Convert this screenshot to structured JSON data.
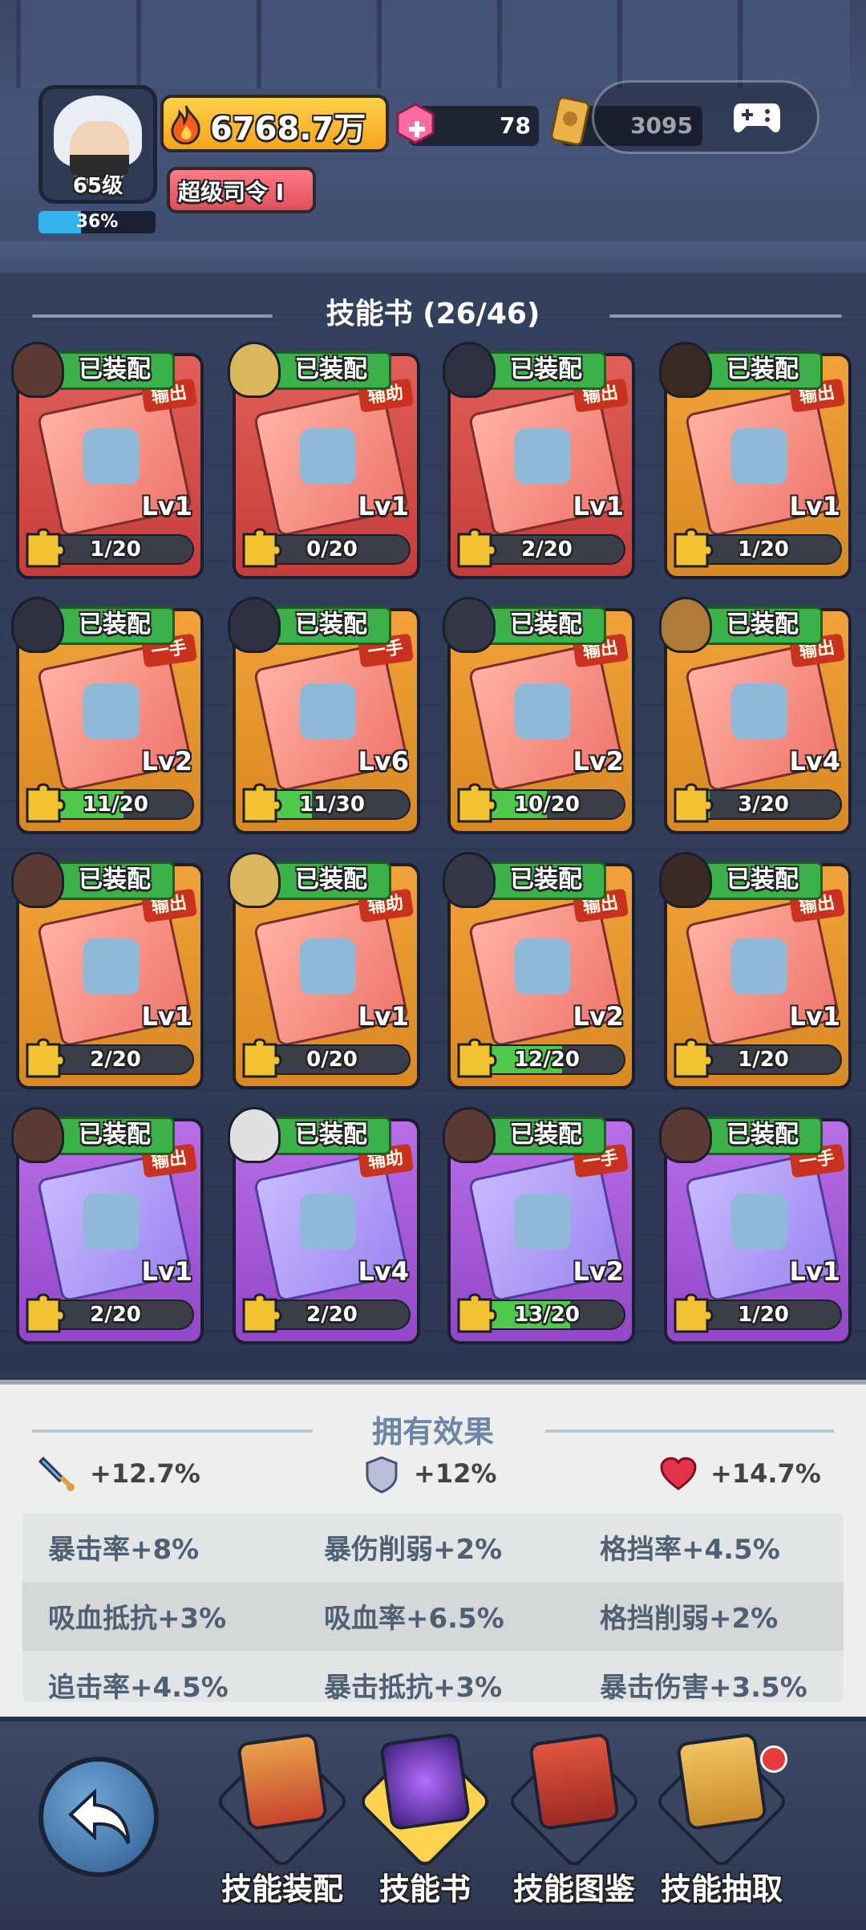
{
  "player": {
    "level": "65级",
    "exp_percent": "36%",
    "exp_fraction": 0.36,
    "power": "6768.7万",
    "title": "超级司令 I",
    "gems": "78",
    "tickets": "3095"
  },
  "section_title": "技能书 (26/46)",
  "cards": [
    {
      "equip": "已装配",
      "tag": "输出",
      "level": "Lv1",
      "progress": "1/20",
      "fill": 0.05,
      "rarity": "red",
      "hero": "#5a3a32"
    },
    {
      "equip": "已装配",
      "tag": "辅助",
      "level": "Lv1",
      "progress": "0/20",
      "fill": 0.0,
      "rarity": "red",
      "hero": "#d9b75a"
    },
    {
      "equip": "已装配",
      "tag": "输出",
      "level": "Lv1",
      "progress": "2/20",
      "fill": 0.1,
      "rarity": "red",
      "hero": "#2f3142"
    },
    {
      "equip": "已装配",
      "tag": "输出",
      "level": "Lv1",
      "progress": "1/20",
      "fill": 0.05,
      "rarity": "orange",
      "hero": "#3a2a22"
    },
    {
      "equip": "已装配",
      "tag": "一手",
      "level": "Lv2",
      "progress": "11/20",
      "fill": 0.55,
      "rarity": "orange",
      "hero": "#2f3142"
    },
    {
      "equip": "已装配",
      "tag": "一手",
      "level": "Lv6",
      "progress": "11/30",
      "fill": 0.37,
      "rarity": "orange",
      "hero": "#2f3142"
    },
    {
      "equip": "已装配",
      "tag": "输出",
      "level": "Lv2",
      "progress": "10/20",
      "fill": 0.5,
      "rarity": "orange",
      "hero": "#343846"
    },
    {
      "equip": "已装配",
      "tag": "输出",
      "level": "Lv4",
      "progress": "3/20",
      "fill": 0.15,
      "rarity": "orange",
      "hero": "#b07a38"
    },
    {
      "equip": "已装配",
      "tag": "输出",
      "level": "Lv1",
      "progress": "2/20",
      "fill": 0.1,
      "rarity": "orange",
      "hero": "#5a3a32"
    },
    {
      "equip": "已装配",
      "tag": "辅助",
      "level": "Lv1",
      "progress": "0/20",
      "fill": 0.0,
      "rarity": "orange",
      "hero": "#d9b75a"
    },
    {
      "equip": "已装配",
      "tag": "输出",
      "level": "Lv2",
      "progress": "12/20",
      "fill": 0.6,
      "rarity": "orange",
      "hero": "#343846"
    },
    {
      "equip": "已装配",
      "tag": "输出",
      "level": "Lv1",
      "progress": "1/20",
      "fill": 0.05,
      "rarity": "orange",
      "hero": "#3a2a22"
    },
    {
      "equip": "已装配",
      "tag": "输出",
      "level": "Lv1",
      "progress": "2/20",
      "fill": 0.1,
      "rarity": "purple",
      "hero": "#5a3a32"
    },
    {
      "equip": "已装配",
      "tag": "辅助",
      "level": "Lv4",
      "progress": "2/20",
      "fill": 0.1,
      "rarity": "purple",
      "hero": "#e0e0e0"
    },
    {
      "equip": "已装配",
      "tag": "一手",
      "level": "Lv2",
      "progress": "13/20",
      "fill": 0.65,
      "rarity": "purple",
      "hero": "#5a3a32"
    },
    {
      "equip": "已装配",
      "tag": "一手",
      "level": "Lv1",
      "progress": "1/20",
      "fill": 0.05,
      "rarity": "purple",
      "hero": "#5a3a32"
    }
  ],
  "effects": {
    "title": "拥有效果",
    "attack": "+12.7%",
    "defense": "+12%",
    "hp": "+14.7%",
    "rows": [
      [
        "暴击率+8%",
        "暴伤削弱+2%",
        "格挡率+4.5%"
      ],
      [
        "吸血抵抗+3%",
        "吸血率+6.5%",
        "格挡削弱+2%"
      ],
      [
        "追击率+4.5%",
        "暴击抵抗+3%",
        "暴击伤害+3.5%"
      ]
    ]
  },
  "nav": {
    "items": [
      "技能装配",
      "技能书",
      "技能图鉴",
      "技能抽取"
    ],
    "active": 1
  },
  "colors": {
    "equipped_green": "#3bb14a",
    "progress_green": "#4ec94a",
    "accent_gold": "#ffd14a"
  }
}
